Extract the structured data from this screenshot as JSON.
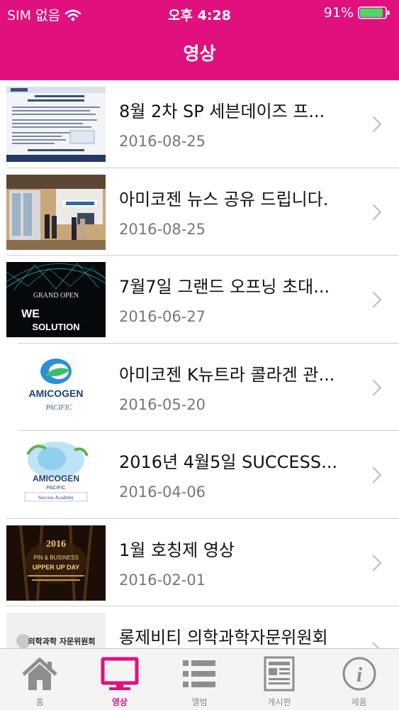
{
  "status_bar": {
    "carrier": "SIM 없음",
    "time": "오후 4:28",
    "battery_percent": "91%",
    "battery_level": 0.91
  },
  "header": {
    "title": "영상"
  },
  "videos": [
    {
      "title": "8월 2차 SP 세븐데이즈 프...",
      "date": "2016-08-25"
    },
    {
      "title": "아미코젠 뉴스 공유 드립니다.",
      "date": "2016-08-25"
    },
    {
      "title": "7월7일 그랜드 오프닝 초대...",
      "date": "2016-06-27",
      "thumb_text": [
        "GRAND OPEN",
        "WE",
        "SOLUTION"
      ]
    },
    {
      "title": "아미코젠 K뉴트라 콜라겐 관...",
      "date": "2016-05-20",
      "thumb_text": [
        "AMICOGEN",
        "PACIFIC"
      ]
    },
    {
      "title": "2016년 4월5일 SUCCESS...",
      "date": "2016-04-06",
      "thumb_text": [
        "AMICOGEN",
        "PACIFIC",
        "Success Academy"
      ]
    },
    {
      "title": "1월 호칭제 영상",
      "date": "2016-02-01",
      "thumb_text": [
        "2016",
        "PIN & BUSINESS",
        "UPPER UP DAY"
      ]
    },
    {
      "title": "롱제비티 의학과학자문위원회",
      "date": "",
      "thumb_text": [
        "의학과학 자문위원회"
      ]
    }
  ],
  "tabs": [
    {
      "label": "홈",
      "icon": "home-icon",
      "active": false
    },
    {
      "label": "영상",
      "icon": "monitor-icon",
      "active": true
    },
    {
      "label": "앨범",
      "icon": "list-icon",
      "active": false
    },
    {
      "label": "게시판",
      "icon": "board-icon",
      "active": false
    },
    {
      "label": "제품",
      "icon": "info-icon",
      "active": false
    }
  ],
  "colors": {
    "accent": "#e0117f",
    "battery": "#4cd964",
    "tab_inactive": "#8e8e8e"
  }
}
